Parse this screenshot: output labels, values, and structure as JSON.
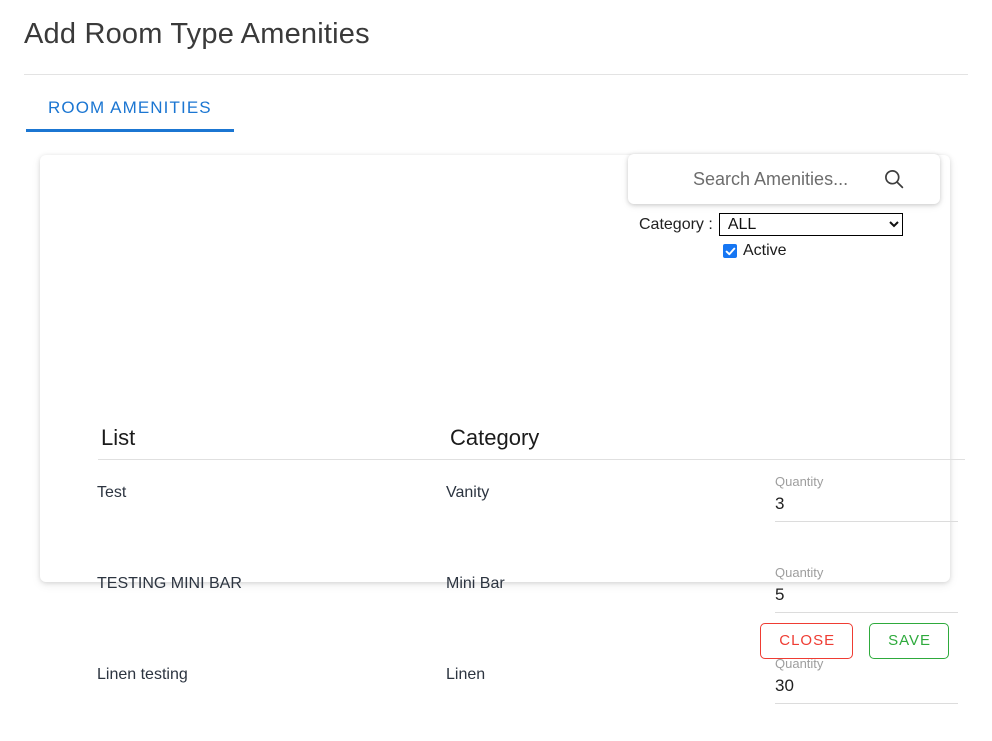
{
  "page": {
    "title": "Add Room Type Amenities"
  },
  "tabs": [
    {
      "label": "ROOM AMENITIES",
      "active": true
    }
  ],
  "search": {
    "placeholder": "Search Amenities...",
    "value": "",
    "icon": "search-icon"
  },
  "filters": {
    "category_label": "Category :",
    "category_value": "ALL",
    "category_options": [
      "ALL"
    ],
    "active_label": "Active",
    "active_checked": true
  },
  "table": {
    "headers": {
      "list": "List",
      "category": "Category"
    },
    "quantity_label": "Quantity",
    "rows": [
      {
        "name": "Test",
        "category": "Vanity",
        "quantity": "3"
      },
      {
        "name": "TESTING MINI BAR",
        "category": "Mini Bar",
        "quantity": "5"
      },
      {
        "name": "Linen testing",
        "category": "Linen",
        "quantity": "30"
      }
    ]
  },
  "footer": {
    "close_label": "CLOSE",
    "save_label": "SAVE"
  },
  "colors": {
    "tab_blue": "#1b76d2",
    "checkbox_blue": "#1676f3",
    "close_red": "#ef3c33",
    "save_green": "#2eaa3c",
    "row_text": "#2c3440",
    "muted_label": "#9e9e9e"
  }
}
